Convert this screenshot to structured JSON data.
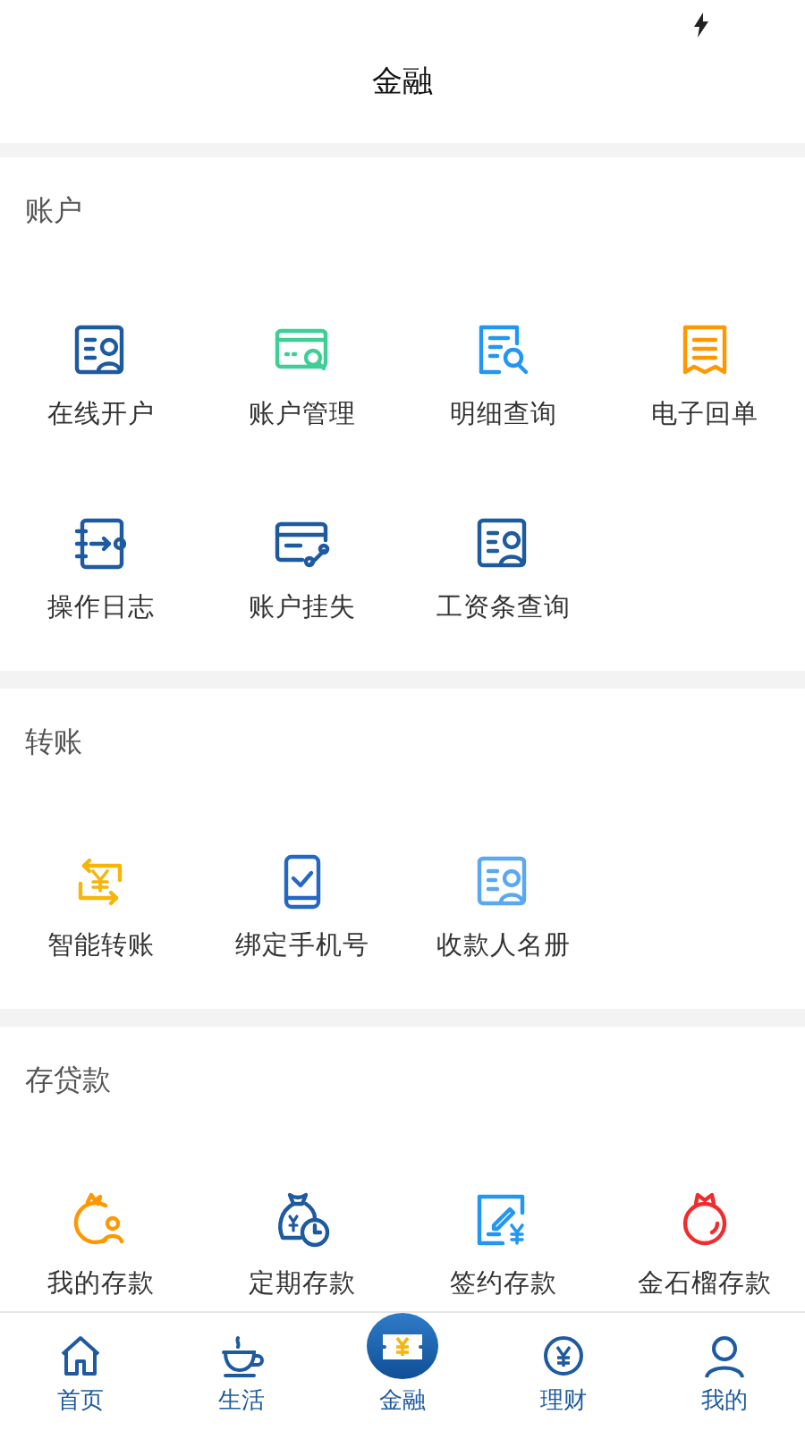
{
  "header": {
    "title": "金融"
  },
  "sections": [
    {
      "title": "账户",
      "items": [
        {
          "label": "在线开户"
        },
        {
          "label": "账户管理"
        },
        {
          "label": "明细查询"
        },
        {
          "label": "电子回单"
        },
        {
          "label": "操作日志"
        },
        {
          "label": "账户挂失"
        },
        {
          "label": "工资条查询"
        }
      ]
    },
    {
      "title": "转账",
      "items": [
        {
          "label": "智能转账"
        },
        {
          "label": "绑定手机号"
        },
        {
          "label": "收款人名册"
        }
      ]
    },
    {
      "title": "存贷款",
      "items": [
        {
          "label": "我的存款"
        },
        {
          "label": "定期存款"
        },
        {
          "label": "签约存款"
        },
        {
          "label": "金石榴存款"
        }
      ]
    }
  ],
  "tabbar": [
    {
      "label": "首页",
      "selected": false
    },
    {
      "label": "生活",
      "selected": false
    },
    {
      "label": "金融",
      "selected": true
    },
    {
      "label": "理财",
      "selected": false
    },
    {
      "label": "我的",
      "selected": false
    }
  ]
}
